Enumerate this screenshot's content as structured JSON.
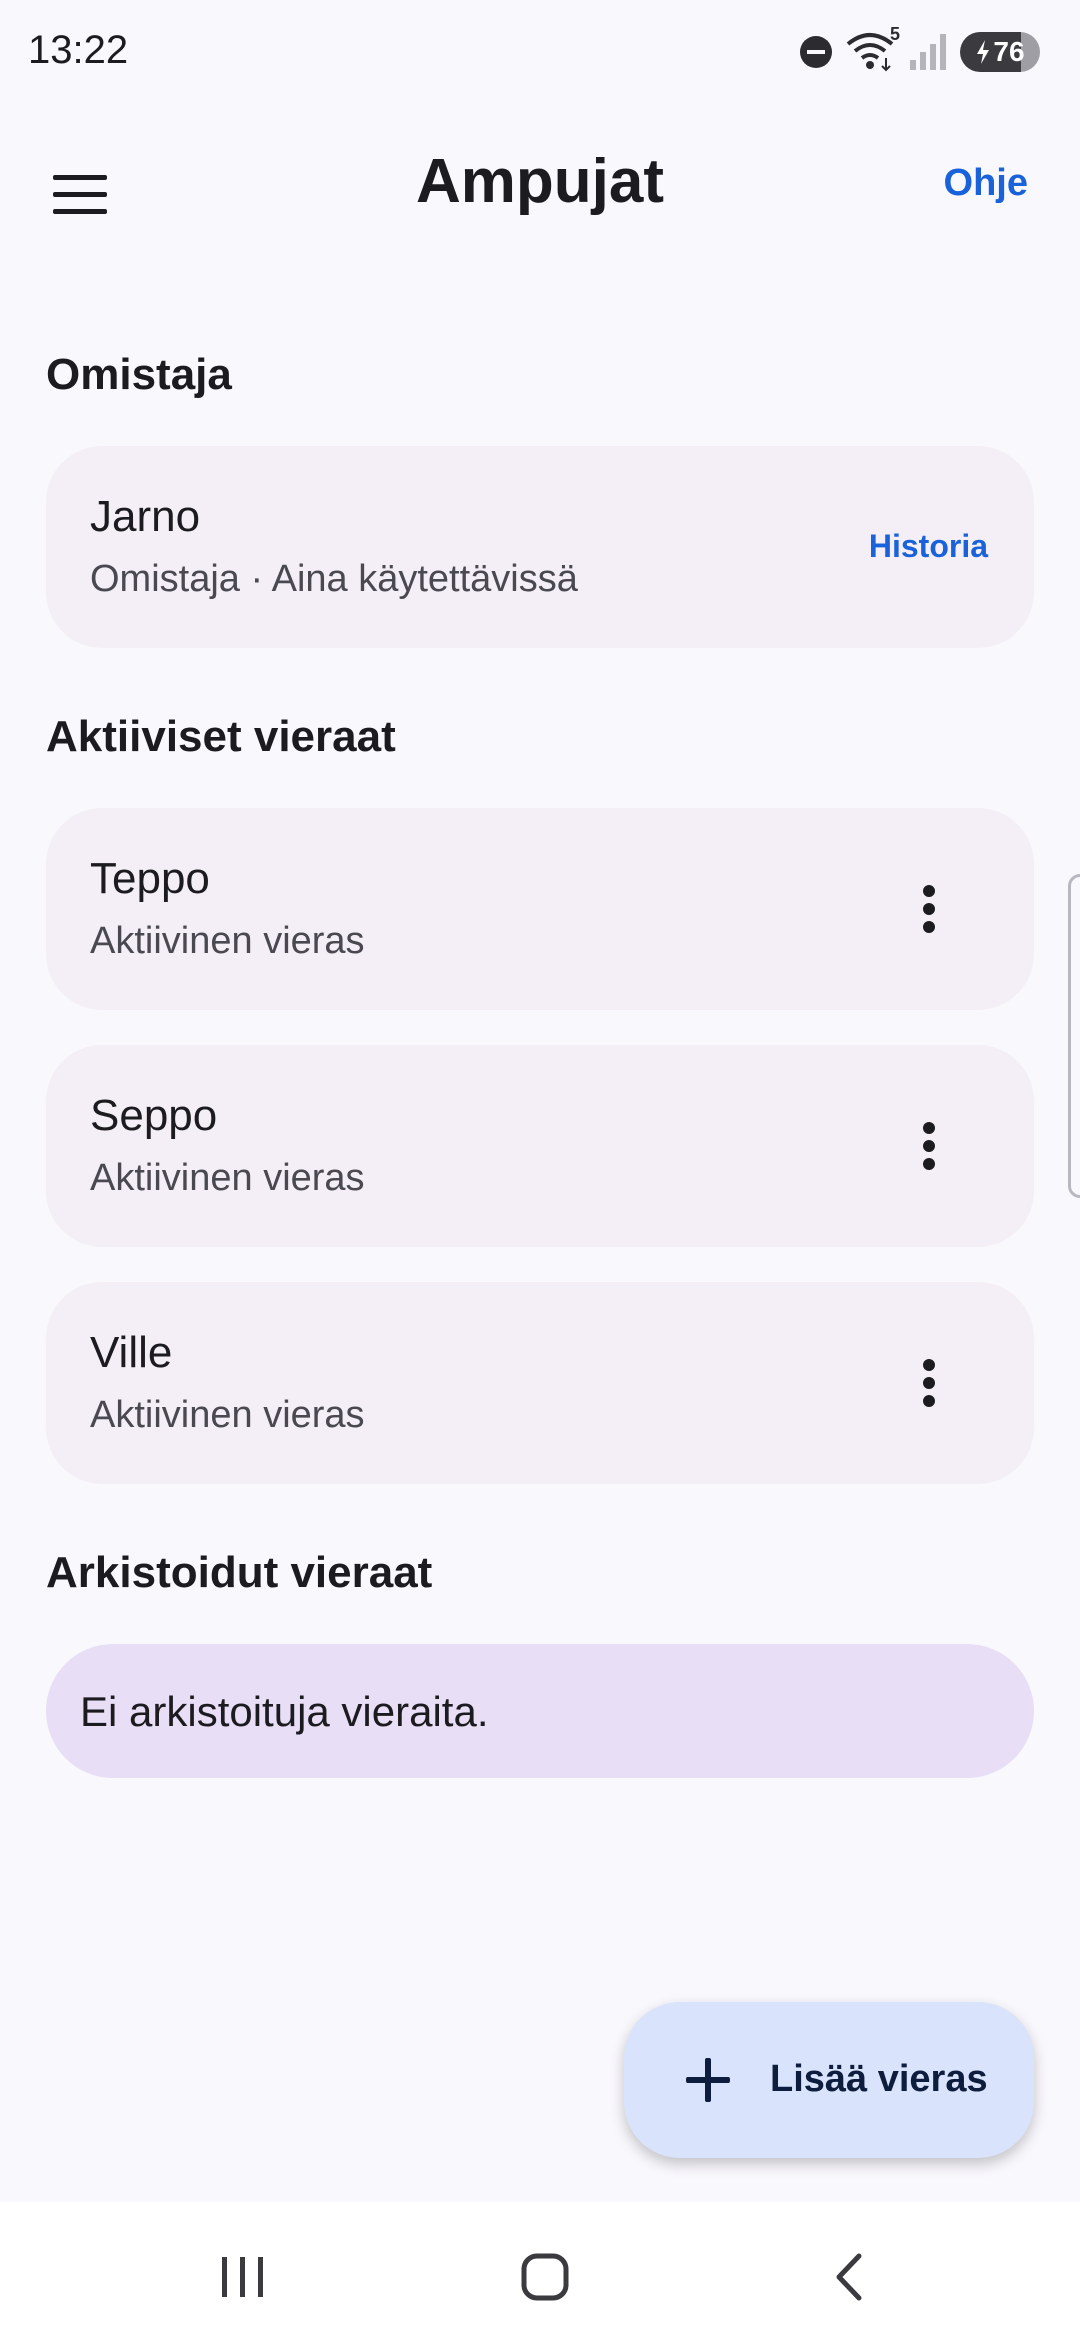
{
  "status_bar": {
    "time": "13:22",
    "battery": {
      "level": 76,
      "label": "76"
    },
    "wifi_badge": "5",
    "icons": [
      "do-not-disturb-icon",
      "wifi-icon",
      "signal-icon",
      "battery-icon"
    ]
  },
  "app_bar": {
    "title": "Ampujat",
    "help_label": "Ohje",
    "menu_icon": "hamburger-menu-icon"
  },
  "owner_section": {
    "heading": "Omistaja",
    "name": "Jarno",
    "subtitle": "Omistaja · Aina käytettävissä",
    "history_label": "Historia"
  },
  "active_section": {
    "heading": "Aktiiviset vieraat",
    "guests": [
      {
        "name": "Teppo",
        "status": "Aktiivinen vieras"
      },
      {
        "name": "Seppo",
        "status": "Aktiivinen vieras"
      },
      {
        "name": "Ville",
        "status": "Aktiivinen vieras"
      }
    ]
  },
  "archived_section": {
    "heading": "Arkistoidut vieraat",
    "empty_text": "Ei arkistoituja vieraita."
  },
  "fab": {
    "label": "Lisää vieras",
    "icon": "plus-icon"
  },
  "nav_bar": {
    "icons": [
      "recent-apps-icon",
      "home-icon",
      "back-icon"
    ]
  },
  "colors": {
    "accent": "#1a62d9",
    "card_bg": "#f4eff6",
    "empty_card_bg": "#e8def5",
    "fab_bg": "#d9e3fb",
    "page_bg": "#f9f8fd"
  }
}
